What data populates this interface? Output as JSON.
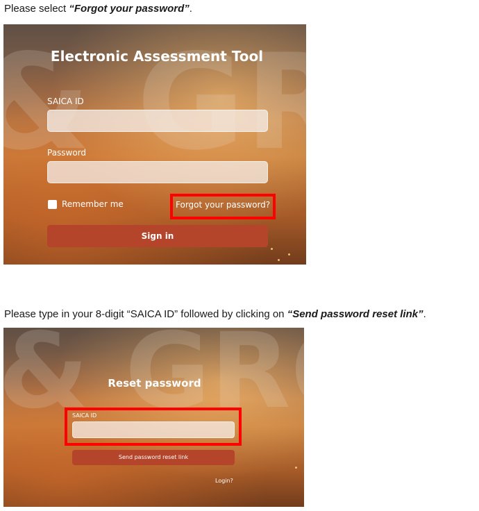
{
  "instructions": {
    "step1_prefix": "Please select ",
    "step1_emphasis": "“Forgot your password”",
    "step1_suffix": ".",
    "step2_prefix": "Please type in your 8-digit “SAICA ID” followed by clicking on ",
    "step2_emphasis": "“Send password reset link”",
    "step2_suffix": "."
  },
  "background": {
    "letters_top": "& GR",
    "letters_bottom": "& GRO"
  },
  "login_screen": {
    "title": "Electronic Assessment Tool",
    "saica_id_label": "SAICA ID",
    "saica_id_value": "",
    "password_label": "Password",
    "password_value": "",
    "remember_me_label": "Remember me",
    "remember_me_checked": false,
    "forgot_password_link": "Forgot your password?",
    "sign_in_button": "Sign in"
  },
  "reset_screen": {
    "title": "Reset password",
    "saica_id_label": "SAICA ID",
    "saica_id_value": "",
    "send_button": "Send password reset link",
    "login_link": "Login?"
  },
  "colors": {
    "highlight": "#ff0000",
    "button": "#b5452a",
    "text_on_dark": "#ffffff"
  }
}
